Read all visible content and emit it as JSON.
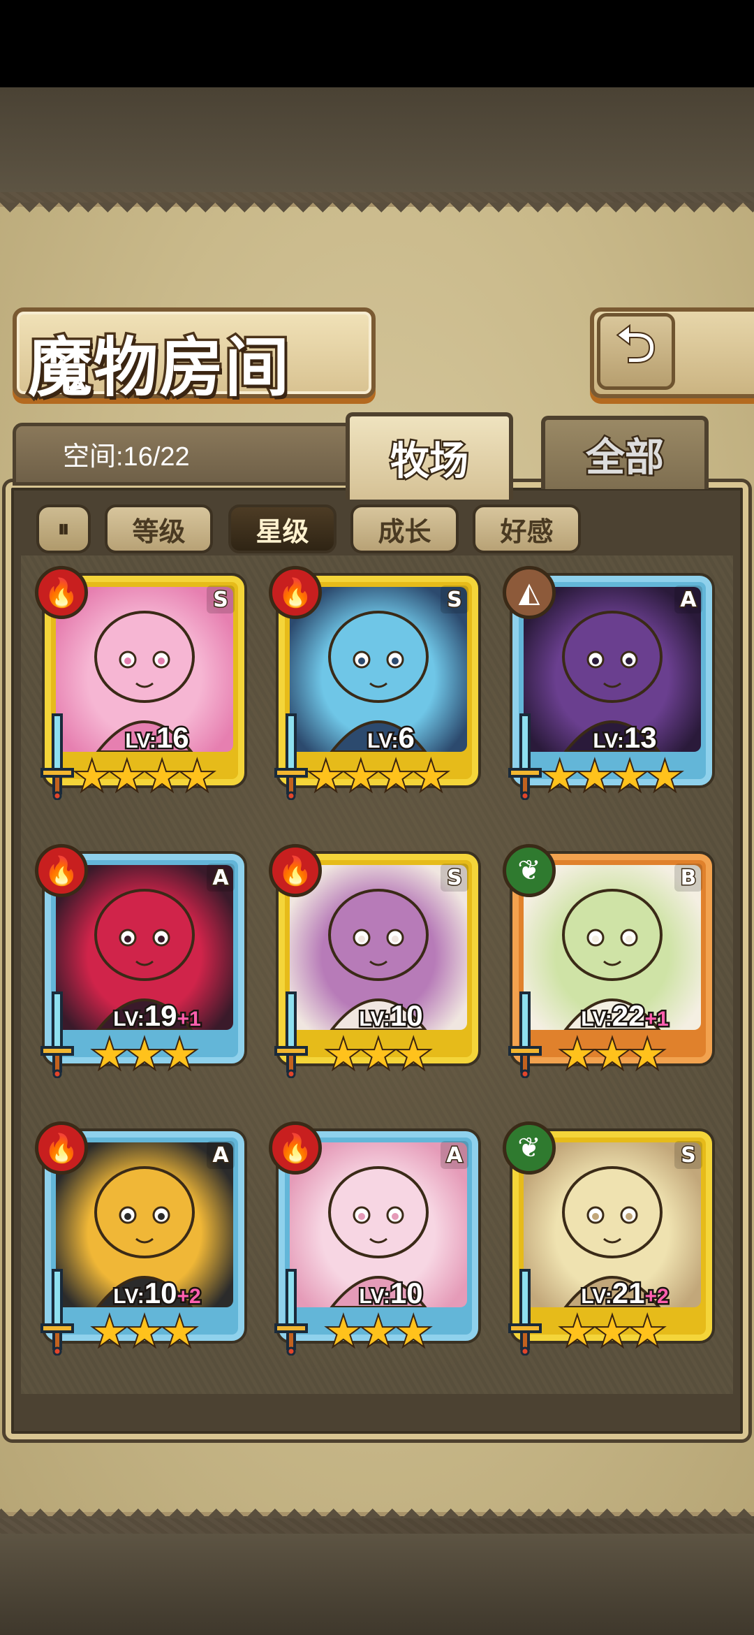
{
  "header": {
    "title": "魔物房间",
    "back_icon": "return-arrow-icon"
  },
  "info": {
    "space_label": "空间:16/22"
  },
  "tabs": [
    {
      "label": "牧场",
      "active": true
    },
    {
      "label": "全部",
      "active": false
    }
  ],
  "filters": {
    "toggle_label": "⏸",
    "items": [
      {
        "label": "等级",
        "active": false
      },
      {
        "label": "星级",
        "active": true
      },
      {
        "label": "成长",
        "active": false
      },
      {
        "label": "好感",
        "active": false
      }
    ]
  },
  "monsters": [
    {
      "element": "fire",
      "rank": "S",
      "level_label": "LV:",
      "level": "16",
      "bonus": "",
      "stars": "★★★★",
      "frame": "gold",
      "colors": [
        "#f6b6d3",
        "#e67fb0"
      ]
    },
    {
      "element": "fire",
      "rank": "S",
      "level_label": "LV:",
      "level": "6",
      "bonus": "",
      "stars": "★★★★",
      "frame": "gold",
      "colors": [
        "#6fc6e7",
        "#2c4a6e"
      ]
    },
    {
      "element": "earth",
      "rank": "A",
      "level_label": "LV:",
      "level": "13",
      "bonus": "",
      "stars": "★★★★",
      "frame": "blue",
      "colors": [
        "#6a3f8f",
        "#2a1a3a"
      ]
    },
    {
      "element": "fire",
      "rank": "A",
      "level_label": "LV:",
      "level": "19",
      "bonus": "+1",
      "stars": "★★★",
      "frame": "blue",
      "colors": [
        "#d0244a",
        "#3a1a2a"
      ]
    },
    {
      "element": "fire",
      "rank": "S",
      "level_label": "LV:",
      "level": "10",
      "bonus": "",
      "stars": "★★★",
      "frame": "gold",
      "colors": [
        "#b77bb8",
        "#f0e6e0"
      ]
    },
    {
      "element": "nature",
      "rank": "B",
      "level_label": "LV:",
      "level": "22",
      "bonus": "+1",
      "stars": "★★★",
      "frame": "orange",
      "colors": [
        "#cfe3a6",
        "#f4efe2"
      ]
    },
    {
      "element": "fire",
      "rank": "A",
      "level_label": "LV:",
      "level": "10",
      "bonus": "+2",
      "stars": "★★★",
      "frame": "blue",
      "colors": [
        "#f0b737",
        "#2b2b2b"
      ]
    },
    {
      "element": "fire",
      "rank": "A",
      "level_label": "LV:",
      "level": "10",
      "bonus": "",
      "stars": "★★★",
      "frame": "blue",
      "colors": [
        "#f7d6e3",
        "#e59bb8"
      ]
    },
    {
      "element": "nature",
      "rank": "S",
      "level_label": "LV:",
      "level": "21",
      "bonus": "+2",
      "stars": "★★★",
      "frame": "gold",
      "colors": [
        "#efe2b0",
        "#c2a77a"
      ]
    }
  ],
  "element_icons": {
    "fire": "🔥",
    "earth": "◭",
    "nature": "❦"
  }
}
